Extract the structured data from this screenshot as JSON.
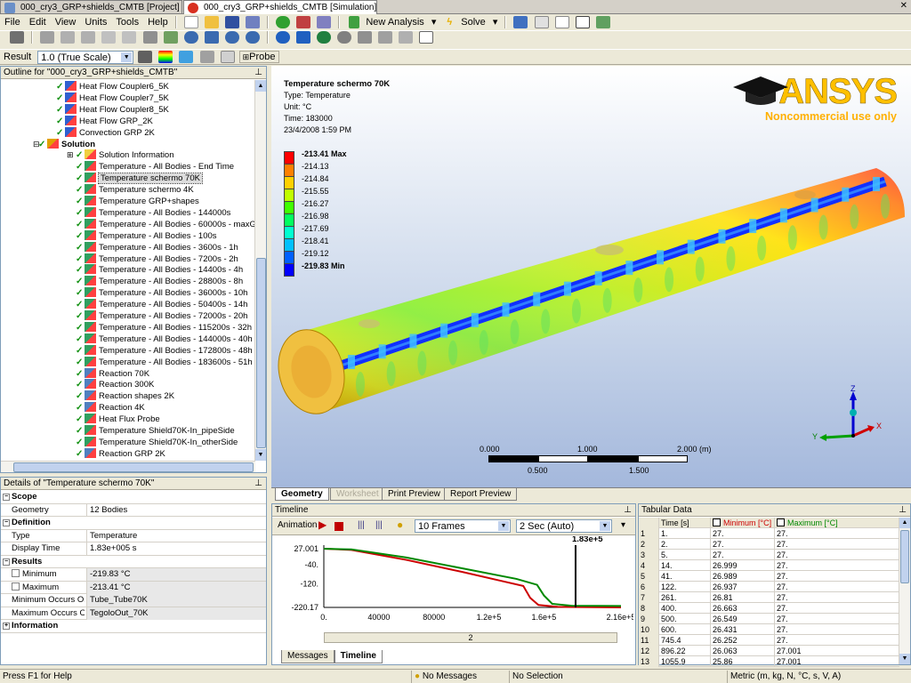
{
  "tabs": [
    {
      "label": "000_cry3_GRP+shields_CMTB [Project]"
    },
    {
      "label": "000_cry3_GRP+shields_CMTB [Simulation]"
    }
  ],
  "menu": [
    "File",
    "Edit",
    "View",
    "Units",
    "Tools",
    "Help"
  ],
  "toolbar": {
    "new_analysis": "New Analysis",
    "solve": "Solve",
    "result_label": "Result",
    "scale_value": "1.0 (True Scale)",
    "probe": "Probe"
  },
  "outline": {
    "title": "Outline for \"000_cry3_GRP+shields_CMTB\"",
    "items": [
      {
        "label": "Heat Flow Coupler6_5K",
        "level": 3
      },
      {
        "label": "Heat Flow Coupler7_5K",
        "level": 3
      },
      {
        "label": "Heat Flow Coupler8_5K",
        "level": 3
      },
      {
        "label": "Heat Flow GRP_2K",
        "level": 3
      },
      {
        "label": "Convection GRP 2K",
        "level": 3
      },
      {
        "label": "Solution",
        "level": 2,
        "bold": true
      },
      {
        "label": "Solution Information",
        "level": 4
      },
      {
        "label": "Temperature - All Bodies - End Time",
        "level": 4
      },
      {
        "label": "Temperature schermo 70K",
        "level": 4,
        "selected": true
      },
      {
        "label": "Temperature schermo 4K",
        "level": 4
      },
      {
        "label": "Temperature GRP+shapes",
        "level": 4
      },
      {
        "label": "Temperature - All Bodies - 144000s",
        "level": 4
      },
      {
        "label": "Temperature - All Bodies - 60000s - maxGradi",
        "level": 4
      },
      {
        "label": "Temperature - All Bodies - 100s",
        "level": 4
      },
      {
        "label": "Temperature - All Bodies - 3600s - 1h",
        "level": 4
      },
      {
        "label": "Temperature - All Bodies - 7200s - 2h",
        "level": 4
      },
      {
        "label": "Temperature - All Bodies - 14400s - 4h",
        "level": 4
      },
      {
        "label": "Temperature - All Bodies - 28800s - 8h",
        "level": 4
      },
      {
        "label": "Temperature - All Bodies - 36000s - 10h",
        "level": 4
      },
      {
        "label": "Temperature - All Bodies - 50400s - 14h",
        "level": 4
      },
      {
        "label": "Temperature - All Bodies - 72000s - 20h",
        "level": 4
      },
      {
        "label": "Temperature - All Bodies - 115200s - 32h",
        "level": 4
      },
      {
        "label": "Temperature - All Bodies - 144000s - 40h",
        "level": 4
      },
      {
        "label": "Temperature - All Bodies - 172800s - 48h",
        "level": 4
      },
      {
        "label": "Temperature - All Bodies - 183600s - 51h",
        "level": 4
      },
      {
        "label": "Reaction 70K",
        "level": 4
      },
      {
        "label": "Reaction 300K",
        "level": 4
      },
      {
        "label": "Reaction shapes 2K",
        "level": 4
      },
      {
        "label": "Reaction 4K",
        "level": 4
      },
      {
        "label": "Heat Flux Probe",
        "level": 4
      },
      {
        "label": "Temperature Shield70K-In_pipeSide",
        "level": 4
      },
      {
        "label": "Temperature Shield70K-In_otherSide",
        "level": 4
      },
      {
        "label": "Reaction GRP 2K",
        "level": 4
      }
    ]
  },
  "details": {
    "title": "Details of \"Temperature schermo 70K\"",
    "rows": [
      {
        "type": "section",
        "k": "Scope"
      },
      {
        "k": "Geometry",
        "v": "12 Bodies"
      },
      {
        "type": "section",
        "k": "Definition"
      },
      {
        "k": "Type",
        "v": "Temperature"
      },
      {
        "k": "Display Time",
        "v": "1.83e+005 s"
      },
      {
        "type": "section",
        "k": "Results"
      },
      {
        "k": "Minimum",
        "v": "-219.83 °C",
        "check": true
      },
      {
        "k": "Maximum",
        "v": "-213.41 °C",
        "check": true
      },
      {
        "k": "Minimum Occurs On",
        "v": "Tube_Tube70K"
      },
      {
        "k": "Maximum Occurs On",
        "v": "TegoloOut_70K"
      },
      {
        "type": "section",
        "k": "Information",
        "collapsed": true
      }
    ]
  },
  "viewport": {
    "result_title": "Temperature schermo 70K",
    "type_line": "Type: Temperature",
    "unit_line": "Unit: °C",
    "time_line": "Time: 183000",
    "date_line": "23/4/2008 1:59 PM",
    "brand": "ANSYS",
    "brand_sub": "Noncommercial use only",
    "legend": [
      {
        "label": "-213.41 Max",
        "color": "#ff0000",
        "bold": true
      },
      {
        "label": "-214.13",
        "color": "#ff8000"
      },
      {
        "label": "-214.84",
        "color": "#ffd000"
      },
      {
        "label": "-215.55",
        "color": "#c0ff00"
      },
      {
        "label": "-216.27",
        "color": "#40ff00"
      },
      {
        "label": "-216.98",
        "color": "#00ff60"
      },
      {
        "label": "-217.69",
        "color": "#00ffd0"
      },
      {
        "label": "-218.41",
        "color": "#00c0ff"
      },
      {
        "label": "-219.12",
        "color": "#0060ff"
      },
      {
        "label": "-219.83 Min",
        "color": "#0000ff",
        "bold": true
      }
    ],
    "scale": {
      "top": [
        "0.000",
        "1.000",
        "2.000 (m)"
      ],
      "bottom": [
        "0.500",
        "1.500"
      ]
    },
    "axes": {
      "z": "Z",
      "y": "Y",
      "x": "X"
    }
  },
  "viewtabs": [
    "Geometry",
    "Worksheet",
    "Print Preview",
    "Report Preview"
  ],
  "timeline": {
    "title": "Timeline",
    "animation": "Animation",
    "frames": "10 Frames",
    "speed": "2 Sec (Auto)",
    "marker_label": "1.83e+5",
    "step": "2",
    "tabs": [
      "Messages",
      "Timeline"
    ],
    "chart_data": {
      "type": "line",
      "yticks": [
        "27.001",
        "-40.",
        "-120.",
        "-220.17"
      ],
      "xticks": [
        "0.",
        "40000",
        "80000",
        "1.2e+5",
        "1.6e+5",
        "2.16e+5"
      ],
      "xlim": [
        0,
        216000
      ],
      "ylim": [
        -220.17,
        27.001
      ],
      "marker_x": 183000,
      "series": [
        {
          "name": "Minimum [°C]",
          "color": "#cc0000",
          "x": [
            0,
            20000,
            60000,
            100000,
            130000,
            145000,
            150000,
            156000,
            170000,
            216000
          ],
          "y": [
            27,
            22,
            -20,
            -70,
            -110,
            -130,
            -180,
            -210,
            -218,
            -220
          ]
        },
        {
          "name": "Maximum [°C]",
          "color": "#008800",
          "x": [
            0,
            20000,
            60000,
            100000,
            140000,
            155000,
            160000,
            166000,
            180000,
            216000
          ],
          "y": [
            27,
            24,
            -10,
            -55,
            -100,
            -125,
            -170,
            -205,
            -213,
            -214
          ]
        }
      ]
    }
  },
  "tabular": {
    "title": "Tabular Data",
    "headers": [
      "",
      "Time [s]",
      "Minimum [°C]",
      "Maximum [°C]"
    ],
    "rows": [
      [
        "1",
        "1.",
        "27.",
        "27."
      ],
      [
        "2",
        "2.",
        "27.",
        "27."
      ],
      [
        "3",
        "5.",
        "27.",
        "27."
      ],
      [
        "4",
        "14.",
        "26.999",
        "27."
      ],
      [
        "5",
        "41.",
        "26.989",
        "27."
      ],
      [
        "6",
        "122.",
        "26.937",
        "27."
      ],
      [
        "7",
        "261.",
        "26.81",
        "27."
      ],
      [
        "8",
        "400.",
        "26.663",
        "27."
      ],
      [
        "9",
        "500.",
        "26.549",
        "27."
      ],
      [
        "10",
        "600.",
        "26.431",
        "27."
      ],
      [
        "11",
        "745.4",
        "26.252",
        "27."
      ],
      [
        "12",
        "896.22",
        "26.063",
        "27.001"
      ],
      [
        "13",
        "1055.9",
        "25.86",
        "27.001"
      ]
    ]
  },
  "status": {
    "help": "Press F1 for Help",
    "messages": "No Messages",
    "selection": "No Selection",
    "units": "Metric (m, kg, N, °C, s, V, A)"
  }
}
